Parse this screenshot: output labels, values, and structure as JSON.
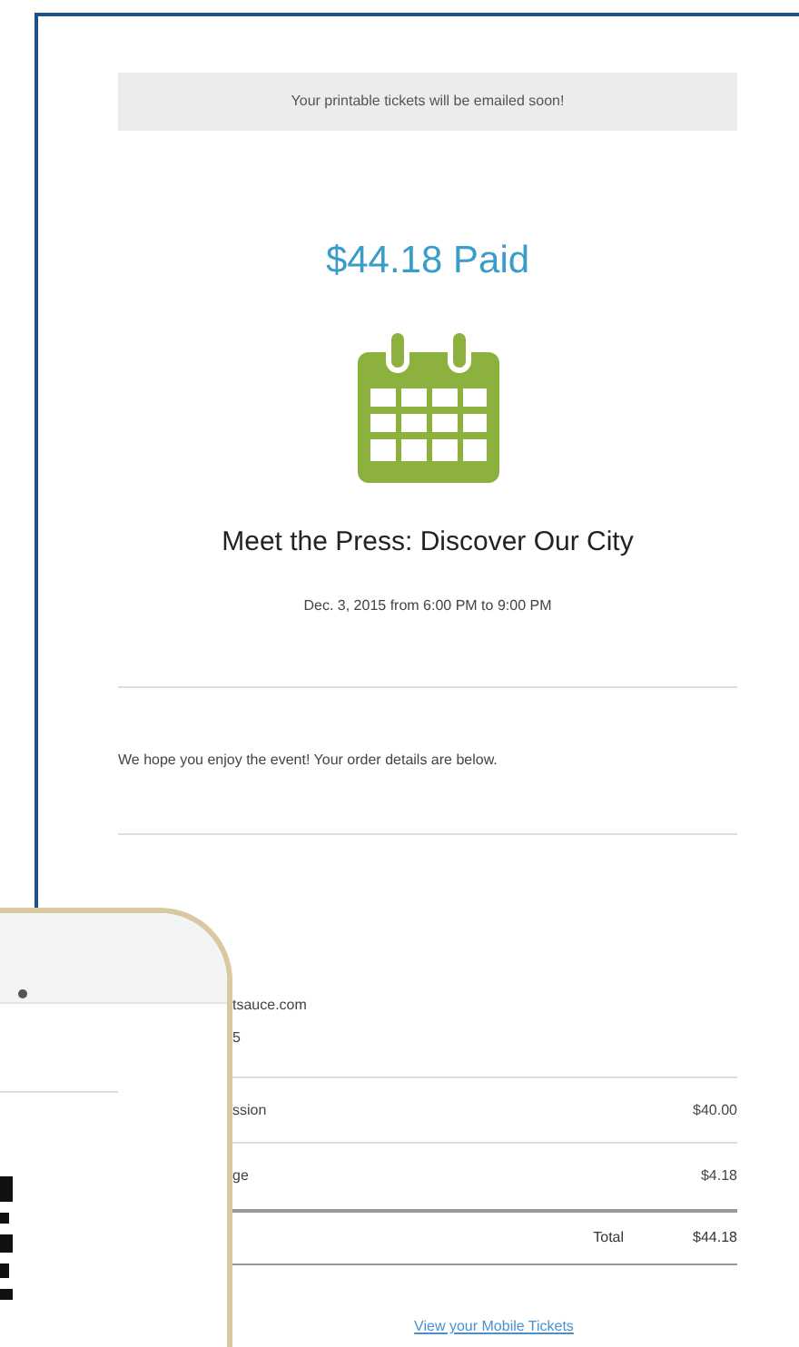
{
  "banner": "Your printable tickets will be emailed soon!",
  "amount": "$44.18 Paid",
  "event": {
    "title": "Meet the Press: Discover Our City",
    "when": "Dec. 3, 2015 from 6:00 PM to 9:00 PM"
  },
  "message": "We hope you enjoy the event! Your order details are below.",
  "buyer": [
    "tsauce.com",
    "5"
  ],
  "line_items": [
    {
      "label": "ssion",
      "amount": "$40.00"
    },
    {
      "label": "ge",
      "amount": "$4.18"
    }
  ],
  "total": {
    "label": "Total",
    "amount": "$44.18"
  },
  "link": "View your Mobile Tickets"
}
